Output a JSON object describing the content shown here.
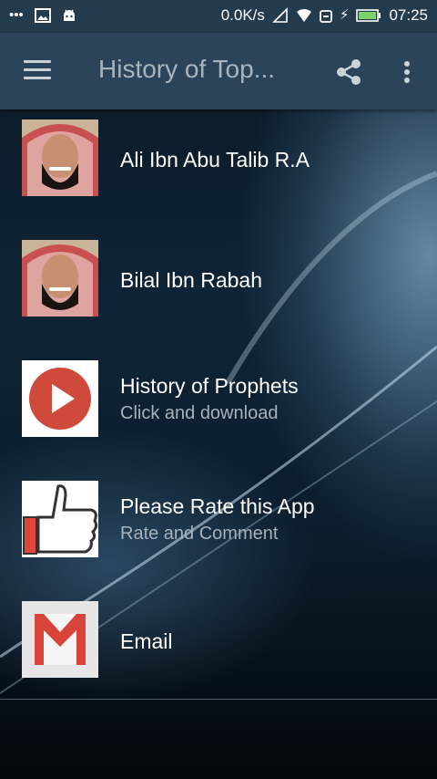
{
  "status_bar": {
    "left_icons": [
      "dots-icon",
      "image-icon",
      "android-icon"
    ],
    "net_speed": "0.0K/s",
    "time": "07:25"
  },
  "app_bar": {
    "title": "History of Top...",
    "menu_icon": "hamburger-icon",
    "share_icon": "share-icon",
    "more_icon": "more-vertical-icon"
  },
  "items": [
    {
      "label": "Ali Ibn Abu Talib R.A",
      "subtitle": "",
      "icon": "speaker-portrait"
    },
    {
      "label": "Bilal Ibn Rabah",
      "subtitle": "",
      "icon": "speaker-portrait"
    },
    {
      "label": "History of Prophets",
      "subtitle": "Click and download",
      "icon": "play-icon"
    },
    {
      "label": "Please Rate this App",
      "subtitle": "Rate and Comment",
      "icon": "thumbs-up-icon"
    },
    {
      "label": "Email",
      "subtitle": "",
      "icon": "gmail-icon"
    }
  ],
  "colors": {
    "appbar": "#2b4459",
    "statusbar": "#243a4d",
    "play_red": "#d04a3c",
    "battery_green": "#7bd36a"
  }
}
